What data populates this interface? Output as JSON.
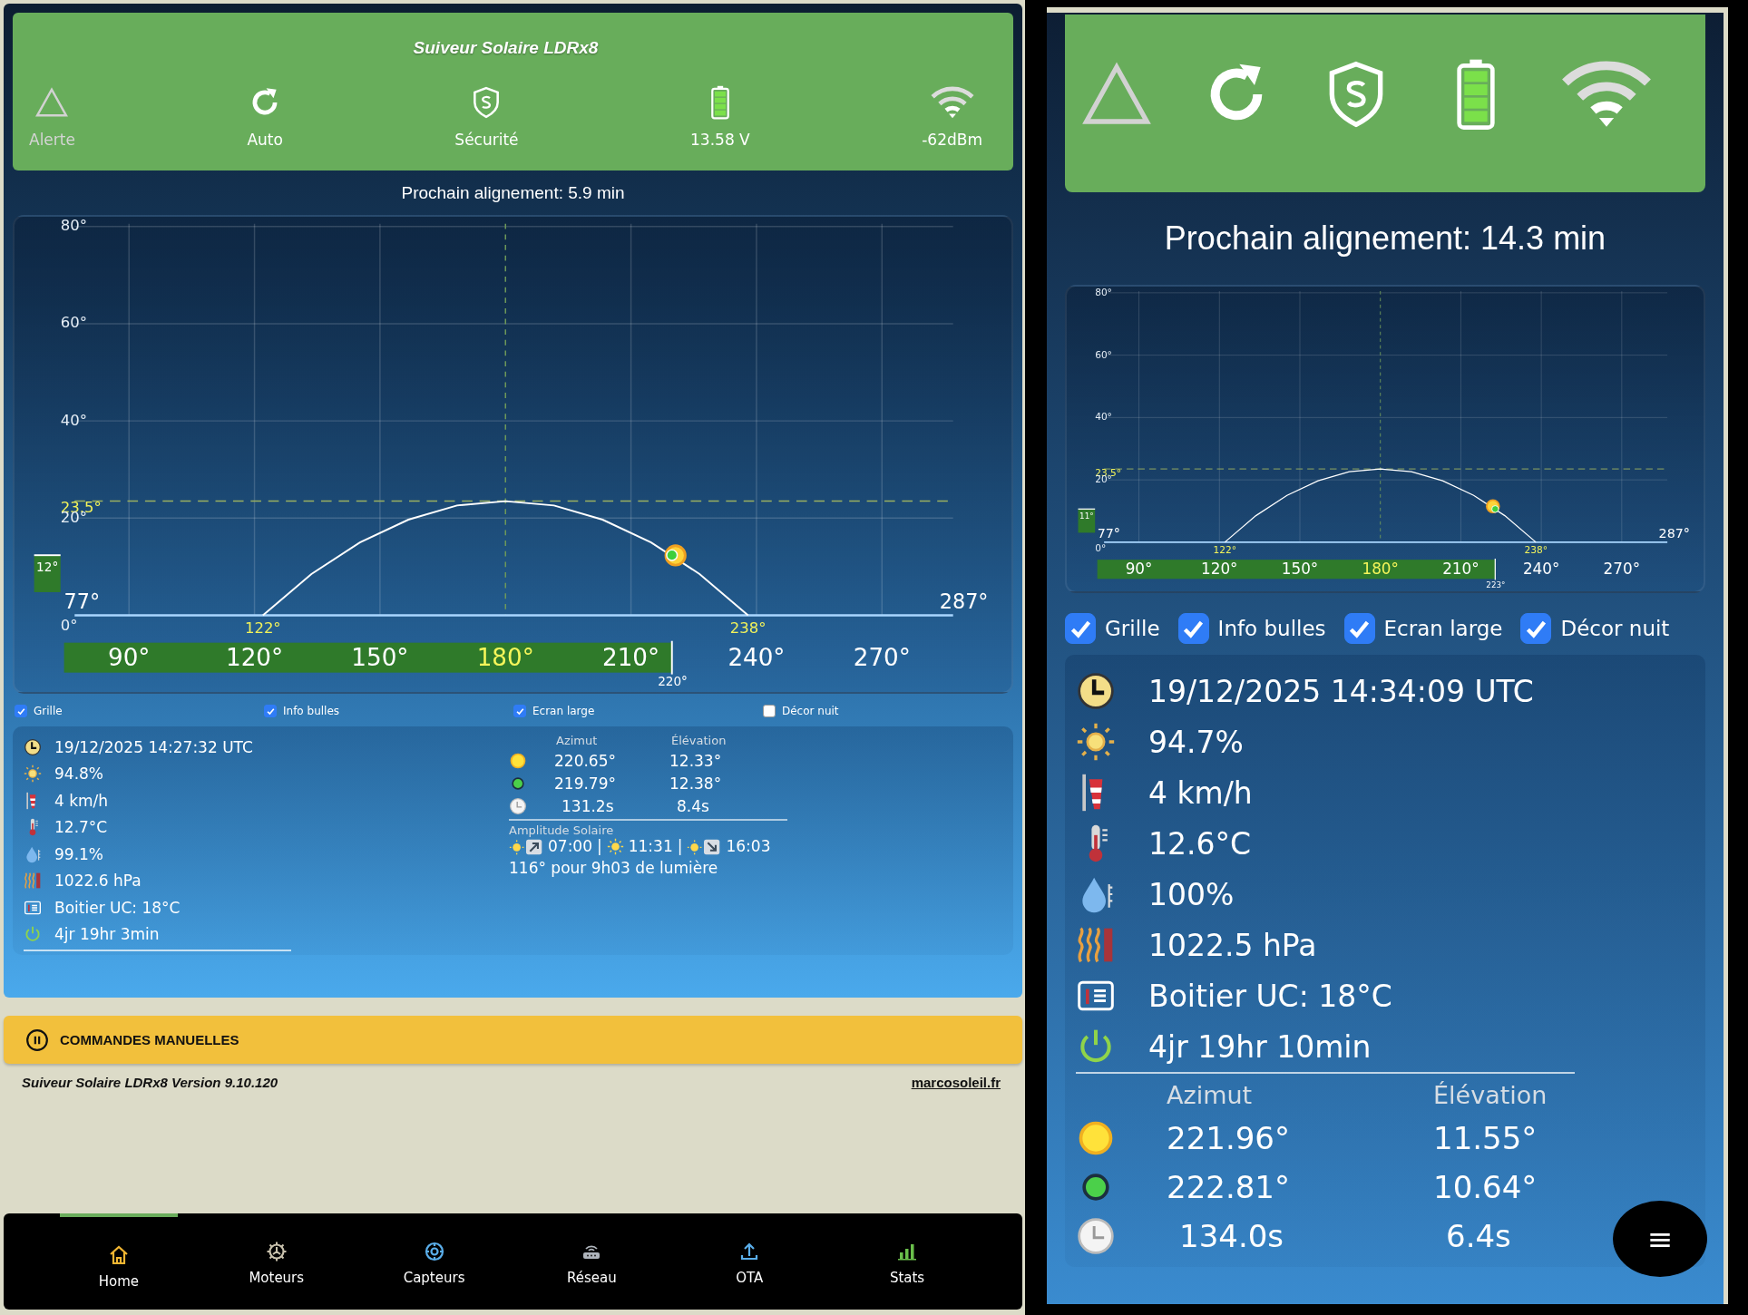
{
  "views": [
    {
      "kind": "wide",
      "header": {
        "title": "Suiveur Solaire LDRx8",
        "status": [
          {
            "kind": "alert",
            "label": "Alerte",
            "active": false
          },
          {
            "kind": "auto",
            "label": "Auto",
            "active": true
          },
          {
            "kind": "security",
            "label": "Sécurité",
            "active": true
          },
          {
            "kind": "battery",
            "label": "13.58 V",
            "active": true
          },
          {
            "kind": "wifi",
            "label": "-62dBm",
            "active": true
          }
        ]
      },
      "next_alignment": "Prochain alignement: 5.9 min",
      "chart": {
        "chart_data": {
          "type": "line",
          "x": [
            122,
            133.6,
            145.2,
            156.8,
            168.4,
            180,
            191.6,
            203.2,
            214.8,
            226.4,
            238
          ],
          "series": [
            {
              "color": "#ffffff",
              "values": [
                0,
                8.5,
                15,
                19.7,
                22.6,
                23.5,
                22.6,
                19.7,
                15,
                8.5,
                0
              ]
            }
          ],
          "xlim": [
            77,
            287
          ],
          "ylim": [
            0,
            80
          ],
          "xticks": [
            {
              "value": 90,
              "label": "90°"
            },
            {
              "value": 120,
              "label": "120°"
            },
            {
              "value": 150,
              "label": "150°"
            },
            {
              "value": 180,
              "label": "180°"
            },
            {
              "value": 210,
              "label": "210°"
            },
            {
              "value": 240,
              "label": "240°"
            },
            {
              "value": 270,
              "label": "270°"
            }
          ],
          "yticks": [
            {
              "value": 0,
              "label": "0°"
            },
            {
              "value": 20,
              "label": "20°"
            },
            {
              "value": 40,
              "label": "40°"
            },
            {
              "value": 60,
              "label": "60°"
            },
            {
              "value": 80,
              "label": "80°"
            }
          ],
          "grid": true,
          "ref_lines": [
            {
              "axis": "y",
              "value": 23.5,
              "label": "23.5°"
            },
            {
              "axis": "x",
              "value": 180
            }
          ]
        },
        "horizon_labels": [
          "77°",
          "287°"
        ],
        "sunrise_label": "122°",
        "sunset_label": "238°",
        "elevation_label": "12°",
        "azimuth_label": "220°"
      },
      "options": [
        {
          "label": "Grille",
          "checked": true
        },
        {
          "label": "Info bulles",
          "checked": true
        },
        {
          "label": "Ecran large",
          "checked": true
        },
        {
          "label": "Décor nuit",
          "checked": false
        }
      ],
      "readings": [
        {
          "kind": "clock",
          "value": "19/12/2025 14:27:32 UTC"
        },
        {
          "kind": "sun",
          "value": "94.8%"
        },
        {
          "kind": "wind",
          "value": "4 km/h"
        },
        {
          "kind": "temperature",
          "value": "12.7°C"
        },
        {
          "kind": "humidity",
          "value": "99.1%"
        },
        {
          "kind": "pressure",
          "value": "1022.6 hPa"
        },
        {
          "kind": "enclosure",
          "value": "Boitier UC: 18°C"
        },
        {
          "kind": "uptime",
          "value": "4jr 19hr 3min"
        }
      ],
      "positions": {
        "columns": [
          "Azimut",
          "Élévation"
        ],
        "rows": [
          {
            "kind": "sun",
            "values": [
              "220.65°",
              "12.33°"
            ]
          },
          {
            "kind": "tracker",
            "values": [
              "219.79°",
              "12.38°"
            ]
          },
          {
            "kind": "timer",
            "values": [
              "131.2s",
              "8.4s"
            ]
          }
        ]
      },
      "amplitude": {
        "title": "Amplitude Solaire",
        "times": [
          {
            "kind": "rise",
            "time": "07:00",
            "separator": "|"
          },
          {
            "kind": "noon",
            "time": "11:31",
            "separator": "|"
          },
          {
            "kind": "set",
            "time": "16:03"
          }
        ],
        "summary": "116° pour 9h03 de lumière"
      },
      "manual_controls": {
        "label": "COMMANDES MANUELLES"
      },
      "footer": {
        "version": "Suiveur Solaire LDRx8 Version 9.10.120",
        "link": "marcosoleil.fr"
      },
      "nav": [
        {
          "kind": "home",
          "label": "Home",
          "selected": true
        },
        {
          "kind": "motors",
          "label": "Moteurs",
          "selected": false
        },
        {
          "kind": "sensors",
          "label": "Capteurs",
          "selected": false
        },
        {
          "kind": "network",
          "label": "Réseau",
          "selected": false
        },
        {
          "kind": "ota",
          "label": "OTA",
          "selected": false
        },
        {
          "kind": "stats",
          "label": "Stats",
          "selected": false
        }
      ]
    },
    {
      "kind": "narrow",
      "header": {
        "status": [
          {
            "kind": "alert",
            "active": false
          },
          {
            "kind": "auto",
            "active": true
          },
          {
            "kind": "security",
            "active": true
          },
          {
            "kind": "battery",
            "active": true
          },
          {
            "kind": "wifi",
            "active": true
          }
        ]
      },
      "next_alignment": "Prochain alignement: 14.3 min",
      "chart": {
        "chart_data": {
          "type": "line",
          "x": [
            122,
            133.6,
            145.2,
            156.8,
            168.4,
            180,
            191.6,
            203.2,
            214.8,
            226.4,
            238
          ],
          "series": [
            {
              "color": "#ffffff",
              "values": [
                0,
                8.5,
                15,
                19.7,
                22.6,
                23.5,
                22.6,
                19.7,
                15,
                8.5,
                0
              ]
            }
          ],
          "xlim": [
            77,
            287
          ],
          "ylim": [
            0,
            80
          ],
          "xticks": [
            {
              "value": 90,
              "label": "90°"
            },
            {
              "value": 120,
              "label": "120°"
            },
            {
              "value": 150,
              "label": "150°"
            },
            {
              "value": 180,
              "label": "180°"
            },
            {
              "value": 210,
              "label": "210°"
            },
            {
              "value": 240,
              "label": "240°"
            },
            {
              "value": 270,
              "label": "270°"
            }
          ],
          "yticks": [
            {
              "value": 0,
              "label": "0°"
            },
            {
              "value": 20,
              "label": "20°"
            },
            {
              "value": 40,
              "label": "40°"
            },
            {
              "value": 60,
              "label": "60°"
            },
            {
              "value": 80,
              "label": "80°"
            }
          ],
          "grid": true,
          "ref_lines": [
            {
              "axis": "y",
              "value": 23.5,
              "label": "23.5°"
            },
            {
              "axis": "x",
              "value": 180
            }
          ]
        },
        "horizon_labels": [
          "77°",
          "287°"
        ],
        "sunrise_label": "122°",
        "sunset_label": "238°",
        "elevation_label": "11°",
        "azimuth_label": "223°"
      },
      "options": [
        {
          "label": "Grille",
          "checked": true
        },
        {
          "label": "Info bulles",
          "checked": true
        },
        {
          "label": "Ecran large",
          "checked": true
        },
        {
          "label": "Décor nuit",
          "checked": true
        }
      ],
      "readings": [
        {
          "kind": "clock",
          "value": "19/12/2025 14:34:09 UTC"
        },
        {
          "kind": "sun",
          "value": "94.7%"
        },
        {
          "kind": "wind",
          "value": "4 km/h"
        },
        {
          "kind": "temperature",
          "value": "12.6°C"
        },
        {
          "kind": "humidity",
          "value": "100%"
        },
        {
          "kind": "pressure",
          "value": "1022.5 hPa"
        },
        {
          "kind": "enclosure",
          "value": "Boitier UC: 18°C"
        },
        {
          "kind": "uptime",
          "value": "4jr 19hr 10min"
        }
      ],
      "positions": {
        "columns": [
          "Azimut",
          "Élévation"
        ],
        "rows": [
          {
            "kind": "sun",
            "values": [
              "221.96°",
              "11.55°"
            ]
          },
          {
            "kind": "tracker",
            "values": [
              "222.81°",
              "10.64°"
            ]
          },
          {
            "kind": "timer",
            "values": [
              "134.0s",
              "6.4s"
            ]
          }
        ]
      },
      "menu_button": {
        "glyph": "≡"
      }
    }
  ]
}
